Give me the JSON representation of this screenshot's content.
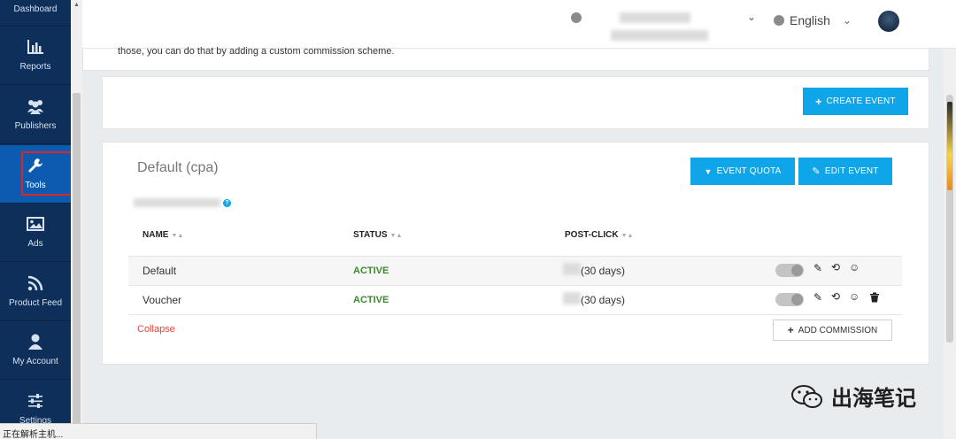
{
  "sidebar": {
    "top_label": "Dashboard",
    "items": [
      {
        "label": "Reports",
        "icon": "bar-chart-icon"
      },
      {
        "label": "Publishers",
        "icon": "users-icon"
      },
      {
        "label": "Tools",
        "icon": "wrench-icon",
        "active": true
      },
      {
        "label": "Ads",
        "icon": "image-icon"
      },
      {
        "label": "Product Feed",
        "icon": "rss-icon"
      },
      {
        "label": "My Account",
        "icon": "user-icon"
      },
      {
        "label": "Settings",
        "icon": "sliders-icon"
      }
    ]
  },
  "header": {
    "language": "English"
  },
  "intro_note": "those, you can do that by adding a custom commission scheme.",
  "create_event_label": "CREATE EVENT",
  "event_card": {
    "title": "Default (cpa)",
    "event_quota_label": "EVENT QUOTA",
    "edit_event_label": "EDIT EVENT",
    "help": "?",
    "columns": {
      "name": "NAME",
      "status": "STATUS",
      "post_click": "POST-CLICK"
    },
    "rows": [
      {
        "name": "Default",
        "status": "ACTIVE",
        "post_click": "(30 days)"
      },
      {
        "name": "Voucher",
        "status": "ACTIVE",
        "post_click": "(30 days)"
      }
    ],
    "collapse_label": "Collapse",
    "add_commission_label": "ADD COMMISSION"
  },
  "statusbar_text": "正在解析主机...",
  "watermark_text": "出海笔记",
  "colors": {
    "sidebar_bg": "#0e2f5a",
    "accent": "#0ea5e9",
    "active_status": "#3a8a2e",
    "collapse_link": "#e0443c",
    "highlight_box": "#e02424"
  }
}
